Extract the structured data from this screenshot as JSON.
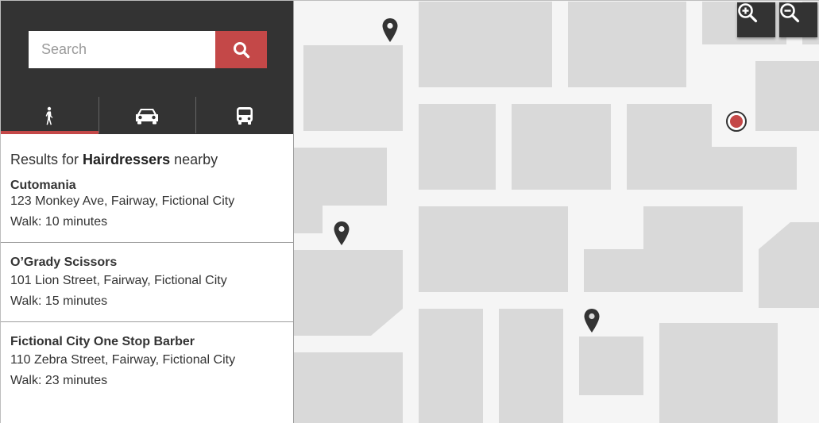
{
  "search": {
    "placeholder": "Search"
  },
  "modes": [
    {
      "id": "walk",
      "icon": "walking-person-icon",
      "active": true
    },
    {
      "id": "car",
      "icon": "car-icon",
      "active": false
    },
    {
      "id": "bus",
      "icon": "bus-icon",
      "active": false
    }
  ],
  "results": {
    "prefix": "Results for ",
    "query": "Hairdressers",
    "suffix": " nearby",
    "items": [
      {
        "name": "Cutomania",
        "address": "123 Monkey Ave, Fairway, Fictional City",
        "walk": "Walk: 10 minutes"
      },
      {
        "name": "O’Grady Scissors",
        "address": "101 Lion Street, Fairway, Fictional City",
        "walk": "Walk: 15 minutes"
      },
      {
        "name": "Fictional City One Stop Barber",
        "address": "110 Zebra Street, Fairway, Fictional City",
        "walk": "Walk: 23 minutes"
      }
    ]
  },
  "map": {
    "zoom_in_icon": "zoom-in-icon",
    "zoom_out_icon": "zoom-out-icon",
    "pin_icon": "map-pin-icon",
    "current_location_icon": "current-location-icon"
  },
  "colors": {
    "header_bg": "#333333",
    "accent": "#c44848",
    "map_bg": "#f5f5f5",
    "map_block": "#d9d9d9"
  }
}
